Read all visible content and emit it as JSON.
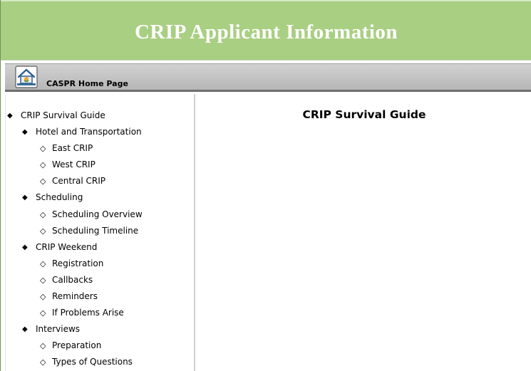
{
  "header": {
    "title": "CRIP Applicant Information",
    "background_color": "#a9cf82"
  },
  "navbar": {
    "home_icon": "home-icon",
    "home_label": "CASPR Home Page"
  },
  "sidebar": {
    "items": [
      {
        "label": "CRIP Survival Guide",
        "level": 0,
        "bullet": "filled-diamond"
      },
      {
        "label": "Hotel and Transportation",
        "level": 1,
        "bullet": "filled-diamond"
      },
      {
        "label": "East CRIP",
        "level": 2,
        "bullet": "hollow-diamond"
      },
      {
        "label": "West CRIP",
        "level": 2,
        "bullet": "hollow-diamond"
      },
      {
        "label": "Central CRIP",
        "level": 2,
        "bullet": "hollow-diamond"
      },
      {
        "label": "Scheduling",
        "level": 1,
        "bullet": "filled-diamond"
      },
      {
        "label": "Scheduling Overview",
        "level": 2,
        "bullet": "hollow-diamond"
      },
      {
        "label": "Scheduling Timeline",
        "level": 2,
        "bullet": "hollow-diamond"
      },
      {
        "label": "CRIP Weekend",
        "level": 1,
        "bullet": "filled-diamond"
      },
      {
        "label": "Registration",
        "level": 2,
        "bullet": "hollow-diamond"
      },
      {
        "label": "Callbacks",
        "level": 2,
        "bullet": "hollow-diamond"
      },
      {
        "label": "Reminders",
        "level": 2,
        "bullet": "hollow-diamond"
      },
      {
        "label": "If Problems Arise",
        "level": 2,
        "bullet": "hollow-diamond"
      },
      {
        "label": "Interviews",
        "level": 1,
        "bullet": "filled-diamond"
      },
      {
        "label": "Preparation",
        "level": 2,
        "bullet": "hollow-diamond"
      },
      {
        "label": "Types of Questions",
        "level": 2,
        "bullet": "hollow-diamond"
      }
    ]
  },
  "main": {
    "title": "CRIP Survival Guide"
  }
}
